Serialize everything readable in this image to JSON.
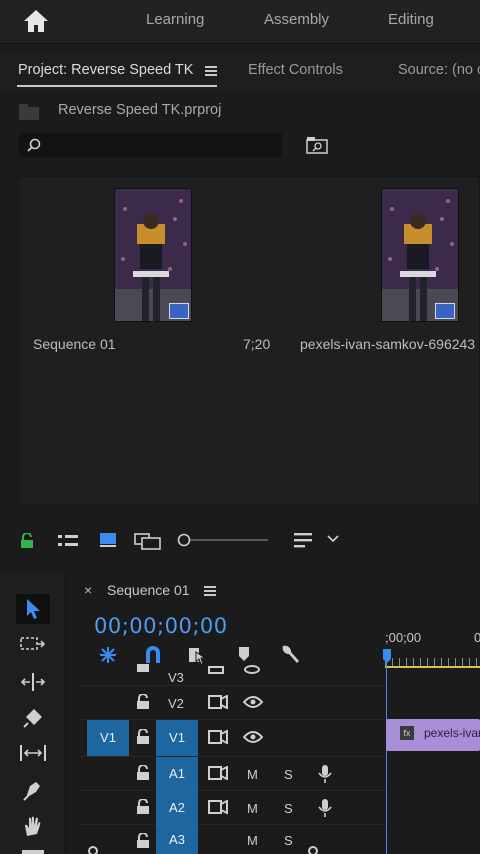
{
  "workspaces": [
    "Learning",
    "Assembly",
    "Editing"
  ],
  "project_panel": {
    "tabs": [
      "Project: Reverse Speed TK",
      "Effect Controls",
      "Source: (no c"
    ],
    "project_file": "Reverse Speed TK.prproj",
    "search": {
      "value": "",
      "placeholder": ""
    },
    "items": [
      {
        "name": "Sequence 01",
        "duration": "7;20"
      },
      {
        "name": "pexels-ivan-samkov-696243",
        "duration": ""
      }
    ]
  },
  "timeline": {
    "sequence_tab": "Sequence 01",
    "timecode": "00;00;00;00",
    "ruler_start": ";00;00",
    "tracks": [
      {
        "id": "V3",
        "type": "video"
      },
      {
        "id": "V2",
        "type": "video"
      },
      {
        "id": "V1",
        "type": "video",
        "source": "V1"
      },
      {
        "id": "A1",
        "type": "audio"
      },
      {
        "id": "A2",
        "type": "audio"
      },
      {
        "id": "A3",
        "type": "audio"
      }
    ],
    "clip": {
      "label": "pexels-ivan",
      "fx": "fx"
    },
    "mute_label": "M",
    "solo_label": "S"
  },
  "colors": {
    "accent": "#3b8cf0",
    "track_target": "#1d66a0",
    "clip": "#a78ed6",
    "lock_green": "#33b24a"
  }
}
